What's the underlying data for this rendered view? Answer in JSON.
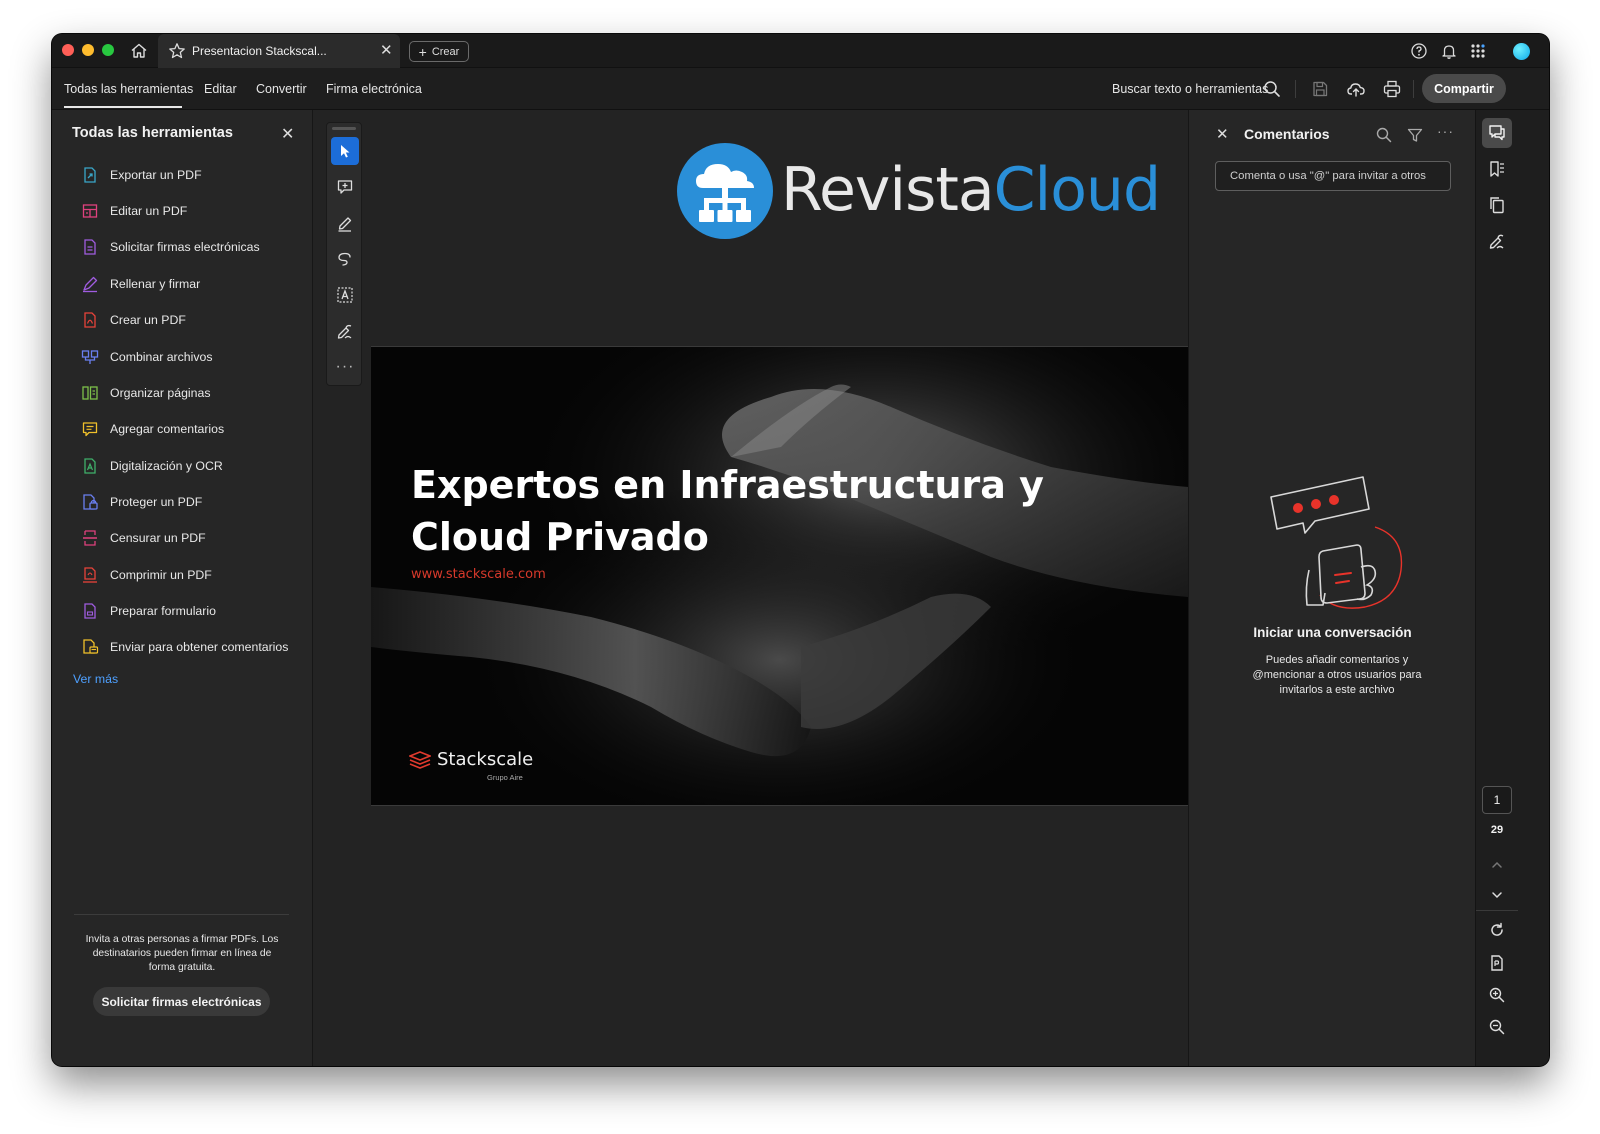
{
  "titlebar": {
    "tab_title": "Presentacion Stackscal...",
    "create_label": "Crear"
  },
  "menubar": {
    "items": [
      "Todas las herramientas",
      "Editar",
      "Convertir",
      "Firma electrónica"
    ],
    "search_label": "Buscar texto o herramientas",
    "share_label": "Compartir"
  },
  "tools_panel": {
    "title": "Todas las herramientas",
    "items": [
      {
        "label": "Exportar un PDF",
        "icon": "export-pdf-icon",
        "color": "#3aa7c9"
      },
      {
        "label": "Editar un PDF",
        "icon": "edit-pdf-icon",
        "color": "#e0417e"
      },
      {
        "label": "Solicitar firmas electrónicas",
        "icon": "request-signature-icon",
        "color": "#a05ce0"
      },
      {
        "label": "Rellenar y firmar",
        "icon": "fill-sign-icon",
        "color": "#a05ce0"
      },
      {
        "label": "Crear un PDF",
        "icon": "create-pdf-icon",
        "color": "#e8433a"
      },
      {
        "label": "Combinar archivos",
        "icon": "combine-files-icon",
        "color": "#6a7ff0"
      },
      {
        "label": "Organizar páginas",
        "icon": "organize-pages-icon",
        "color": "#7cc04a"
      },
      {
        "label": "Agregar comentarios",
        "icon": "add-comments-icon",
        "color": "#f0c02a"
      },
      {
        "label": "Digitalización y OCR",
        "icon": "scan-ocr-icon",
        "color": "#3fb06a"
      },
      {
        "label": "Proteger un PDF",
        "icon": "protect-pdf-icon",
        "color": "#6a7ff0"
      },
      {
        "label": "Censurar un PDF",
        "icon": "redact-pdf-icon",
        "color": "#e0417e"
      },
      {
        "label": "Comprimir un PDF",
        "icon": "compress-pdf-icon",
        "color": "#e8433a"
      },
      {
        "label": "Preparar formulario",
        "icon": "prepare-form-icon",
        "color": "#a05ce0"
      },
      {
        "label": "Enviar para obtener comentarios",
        "icon": "send-comments-icon",
        "color": "#f0c02a"
      }
    ],
    "see_more": "Ver más",
    "promo_text": "Invita a otras personas a firmar PDFs. Los destinatarios pueden firmar en línea de forma gratuita.",
    "promo_button": "Solicitar firmas electrónicas"
  },
  "document": {
    "logo_part1": "Revista",
    "logo_part2": "Cloud",
    "slide_title": "Expertos en Infraestructura y Cloud Privado",
    "slide_url": "www.stackscale.com",
    "brand_name": "Stackscale",
    "brand_sub": "Grupo Aire"
  },
  "comments_panel": {
    "title": "Comentarios",
    "input_placeholder": "Comenta o usa \"@\" para invitar a otros",
    "empty_title": "Iniciar una conversación",
    "empty_text": "Puedes añadir comentarios y @mencionar a otros usuarios para invitarlos a este archivo"
  },
  "page_nav": {
    "current_page": "1",
    "total_pages": "29"
  },
  "colors": {
    "accent_blue": "#1c6dd8",
    "link_blue": "#4ea0ff",
    "brand_red": "#d8392b",
    "logo_blue": "#2a8fd8"
  }
}
